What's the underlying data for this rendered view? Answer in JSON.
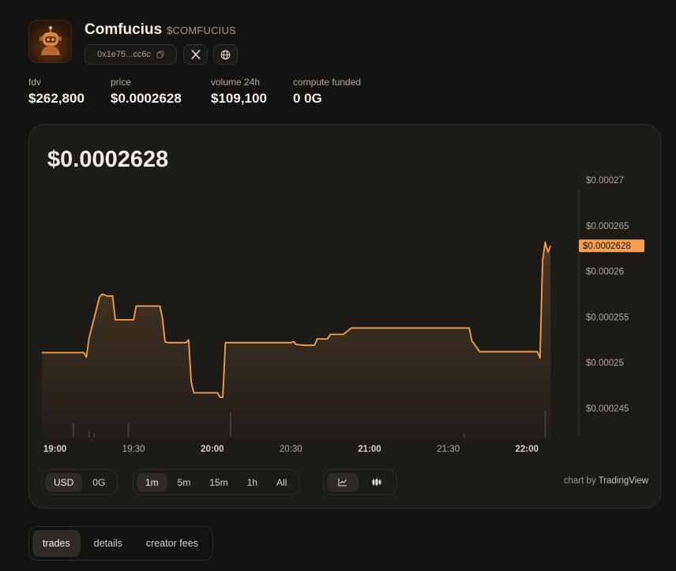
{
  "token": {
    "name": "Comfucius",
    "symbol": "$COMFUCIUS",
    "address": "0x1e75...cc6c",
    "avatar_icon": "robot-sage-avatar",
    "x_icon": "x-logo-icon",
    "web_icon": "globe-icon",
    "copy_icon": "copy-icon"
  },
  "stats": [
    {
      "label": "fdv",
      "value": "$262,800"
    },
    {
      "label": "price",
      "value": "$0.0002628"
    },
    {
      "label": "volume 24h",
      "value": "$109,100"
    },
    {
      "label": "compute funded",
      "value": "0 0G"
    }
  ],
  "chart": {
    "price": "$0.0002628",
    "currency_options": [
      "USD",
      "0G"
    ],
    "currency_selected": "USD",
    "interval_options": [
      "1m",
      "5m",
      "15m",
      "1h",
      "All"
    ],
    "interval_selected": "1m",
    "chart_type_icons": [
      "line-chart-icon",
      "candlestick-icon"
    ],
    "attribution_prefix": "chart by",
    "attribution_brand": "TradingView",
    "colors": {
      "line": "#f5a04e",
      "price_tag": "#f5a04e",
      "volume": "#4a4540"
    }
  },
  "chart_data": {
    "type": "area",
    "x_ticks": [
      "19:00",
      "19:30",
      "20:00",
      "20:30",
      "21:00",
      "21:30",
      "22:00"
    ],
    "x_tick_minutes": [
      0,
      30,
      60,
      90,
      120,
      150,
      180
    ],
    "x_bold_ticks": [
      "19:00",
      "20:00",
      "21:00",
      "22:00"
    ],
    "y_ticks": [
      "$0.00027",
      "$0.000265",
      "$0.00026",
      "$0.000255",
      "$0.00025",
      "$0.000245"
    ],
    "y_tick_values": [
      0.00027,
      0.000265,
      0.00026,
      0.000255,
      0.00025,
      0.000245
    ],
    "ylim": [
      0.0002418,
      0.00027
    ],
    "xlim": [
      -5,
      195
    ],
    "last_price_label": "$0.0002628",
    "last_price": 0.0002628,
    "series": [
      {
        "x": [
          -5,
          11,
          12,
          13,
          17,
          18,
          20,
          22,
          23,
          30,
          31,
          33,
          40,
          41,
          42,
          43,
          50,
          51,
          52,
          53,
          54,
          62,
          63,
          64,
          65,
          70,
          75,
          80,
          85,
          90,
          91,
          92,
          95,
          99,
          100,
          104,
          105,
          110,
          113,
          120,
          125,
          130,
          135,
          140,
          150,
          158,
          159,
          162,
          170,
          180,
          184,
          185,
          186,
          187,
          188,
          189
        ],
        "y": [
          0.0002511,
          0.0002511,
          0.0002506,
          0.0002527,
          0.0002572,
          0.0002575,
          0.0002573,
          0.0002573,
          0.0002547,
          0.0002547,
          0.0002562,
          0.0002562,
          0.0002562,
          0.0002549,
          0.0002523,
          0.0002522,
          0.0002522,
          0.0002525,
          0.0002478,
          0.0002467,
          0.0002467,
          0.0002467,
          0.0002462,
          0.0002462,
          0.0002522,
          0.0002522,
          0.0002522,
          0.0002522,
          0.0002522,
          0.0002522,
          0.0002523,
          0.000252,
          0.0002519,
          0.0002519,
          0.0002526,
          0.0002526,
          0.0002531,
          0.0002531,
          0.0002538,
          0.0002538,
          0.0002538,
          0.0002538,
          0.0002538,
          0.0002538,
          0.0002538,
          0.0002538,
          0.0002524,
          0.0002512,
          0.0002512,
          0.0002512,
          0.0002512,
          0.0002505,
          0.0002612,
          0.0002632,
          0.0002621,
          0.0002628
        ]
      }
    ],
    "volume_x": [
      7,
      13,
      15,
      28,
      67,
      156,
      187
    ],
    "volume_level": [
      0.31,
      0.14,
      0.09,
      0.3,
      0.53,
      0.08,
      0.55
    ]
  },
  "tabs": [
    {
      "label": "trades",
      "active": true
    },
    {
      "label": "details",
      "active": false
    },
    {
      "label": "creator fees",
      "active": false
    }
  ]
}
